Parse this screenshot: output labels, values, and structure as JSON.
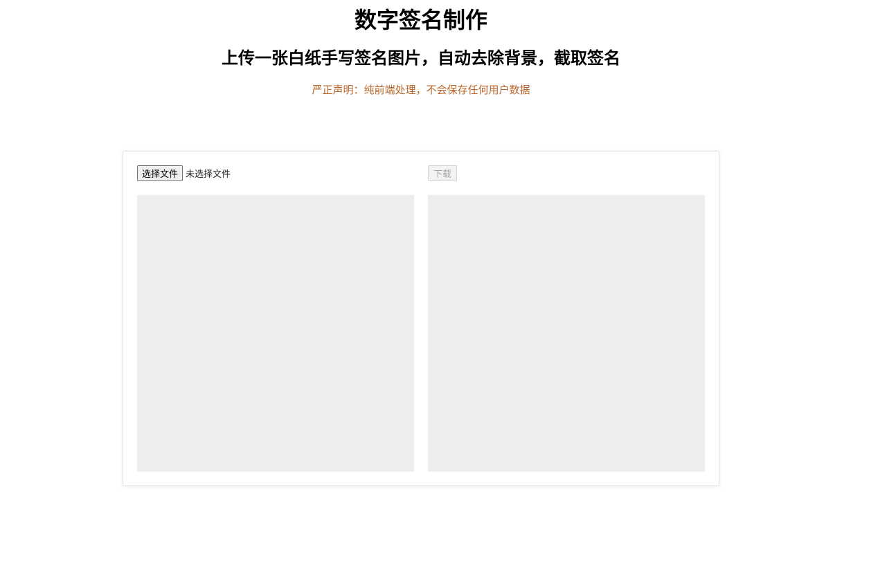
{
  "header": {
    "title": "数字签名制作",
    "subtitle": "上传一张白纸手写签名图片，自动去除背景，截取签名",
    "notice": "严正声明：纯前端处理，不会保存任何用户数据",
    "notice_color": "#b8652a"
  },
  "upload": {
    "button_label": "选择文件",
    "status_text": "未选择文件"
  },
  "download": {
    "button_label": "下载",
    "disabled": true
  },
  "panels": {
    "background_color": "#ededed"
  }
}
